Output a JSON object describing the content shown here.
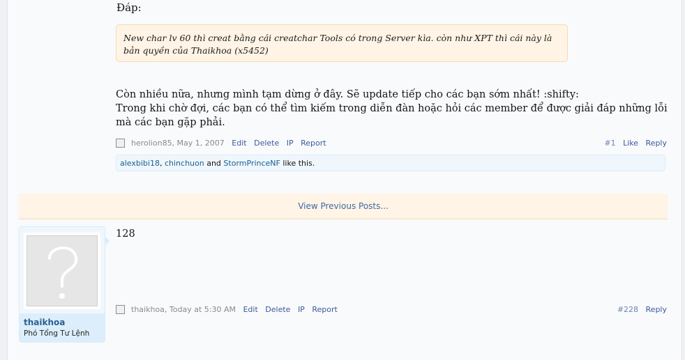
{
  "post1": {
    "lead": "Đáp:",
    "quote": "New char lv 60 thì creat bằng cái creatchar Tools có trong Server kìa. còn như XPT thì cái này là bản quyền của Thaikhoa (x5452)",
    "line1": "Còn nhiều nữa, nhưng mình tạm dừng ở đây. Sẽ update tiếp cho các bạn sớm nhất! :shifty:",
    "line2": "Trong khi chờ đợi, các bạn có thể tìm kiếm trong diễn đàn hoặc hỏi các member để được giải đáp những lỗi mà các bạn gặp phải.",
    "meta": {
      "author_date": "herolion85, May 1, 2007",
      "edit": "Edit",
      "delete": "Delete",
      "ip": "IP",
      "report": "Report",
      "number": "#1",
      "like": "Like",
      "reply": "Reply"
    },
    "likes": {
      "user1": "alexbibi18",
      "sep": ", ",
      "user2": "chinchuon",
      "and": " and ",
      "user3": "StormPrinceNF",
      "suffix": " like this."
    }
  },
  "view_previous": "View Previous Posts...",
  "post2": {
    "user": {
      "name": "thaikhoa",
      "title": "Phó Tổng Tư Lệnh"
    },
    "text": "128",
    "meta": {
      "author_date": "thaikhoa, Today at 5:30 AM",
      "edit": "Edit",
      "delete": "Delete",
      "ip": "IP",
      "report": "Report",
      "number": "#228",
      "reply": "Reply"
    }
  },
  "icons": {
    "avatar": "default-avatar-question-icon",
    "checkbox": "checkbox"
  }
}
